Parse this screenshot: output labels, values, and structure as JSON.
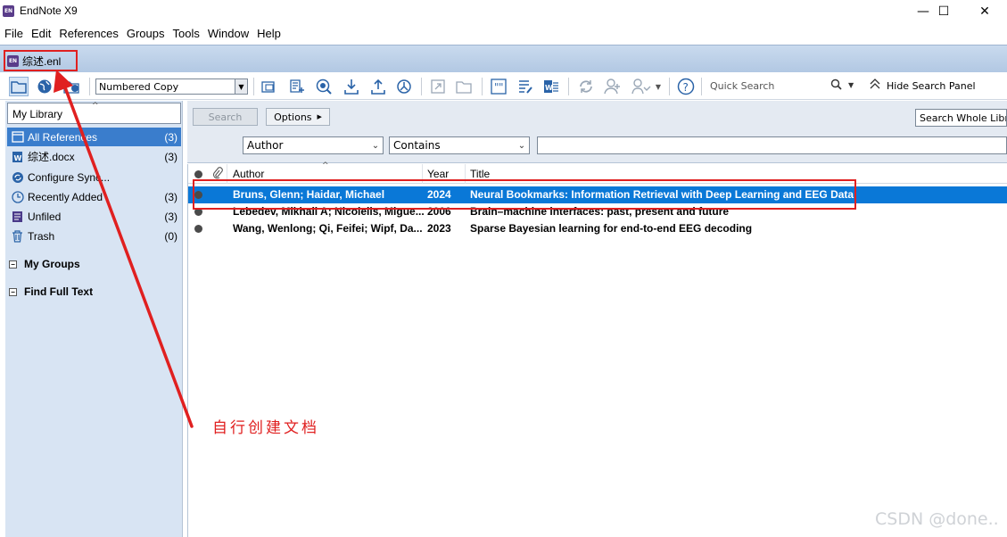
{
  "window": {
    "title": "EndNote X9",
    "app_logo": "EN",
    "controls": {
      "minimize": "—",
      "maximize": "☐",
      "close": "✕"
    }
  },
  "menu": [
    "File",
    "Edit",
    "References",
    "Groups",
    "Tools",
    "Window",
    "Help"
  ],
  "doc_tab": {
    "logo": "EN",
    "label": "综述.enl"
  },
  "toolbar": {
    "style_value": "Numbered Copy",
    "quick_search_placeholder": "Quick Search",
    "hide_search_panel": "Hide Search Panel",
    "icons": [
      "local-library-icon",
      "online-search-icon",
      "integrated-library-icon",
      "copy-to-group-icon",
      "new-reference-icon",
      "online-search-globe-icon",
      "import-icon",
      "export-icon",
      "find-full-text-icon",
      "open-link-icon",
      "open-file-icon",
      "insert-citation-icon",
      "format-bibliography-icon",
      "word-icon",
      "sync-icon",
      "share-icon",
      "group-share-icon",
      "help-icon"
    ]
  },
  "left_pane": {
    "library_label": "My Library",
    "groups": [
      {
        "name": "All References",
        "count": "(3)",
        "icon": "all-references-icon",
        "selected": true
      },
      {
        "name": "综述.docx",
        "count": "(3)",
        "icon": "word-doc-icon",
        "selected": false
      },
      {
        "name": "Configure Sync...",
        "count": "",
        "icon": "sync-icon",
        "selected": false
      },
      {
        "name": "Recently Added",
        "count": "(3)",
        "icon": "clock-icon",
        "selected": false
      },
      {
        "name": "Unfiled",
        "count": "(3)",
        "icon": "unfiled-icon",
        "selected": false
      },
      {
        "name": "Trash",
        "count": "(0)",
        "icon": "trash-icon",
        "selected": false
      }
    ],
    "sections": [
      {
        "name": "My Groups",
        "toggle": "−"
      },
      {
        "name": "Find Full Text",
        "toggle": "−"
      }
    ]
  },
  "search_panel": {
    "search_button": "Search",
    "options_button": "Options",
    "scope": "Search Whole Libr",
    "field": "Author",
    "operator": "Contains",
    "value": ""
  },
  "references": {
    "columns": [
      "Author",
      "Year",
      "Title"
    ],
    "rows": [
      {
        "author": "Bruns, Glenn; Haidar, Michael",
        "year": "2024",
        "title": "Neural Bookmarks: Information Retrieval with Deep Learning and EEG Data",
        "selected": true
      },
      {
        "author": "Lebedev, Mikhail A; Nicolelis, Migue...",
        "year": "2006",
        "title": "Brain–machine interfaces: past, present and future",
        "selected": false
      },
      {
        "author": "Wang, Wenlong; Qi, Feifei; Wipf, Da...",
        "year": "2023",
        "title": "Sparse Bayesian learning for end-to-end EEG decoding",
        "selected": false
      }
    ]
  },
  "annotation": {
    "text": "自行创建文档",
    "color": "#e02020"
  },
  "watermark": "CSDN @done..",
  "colors": {
    "accent": "#0a78d7",
    "group_selected": "#3a7dcc",
    "pane_bg": "#d8e4f3",
    "annotation": "#e02020"
  }
}
